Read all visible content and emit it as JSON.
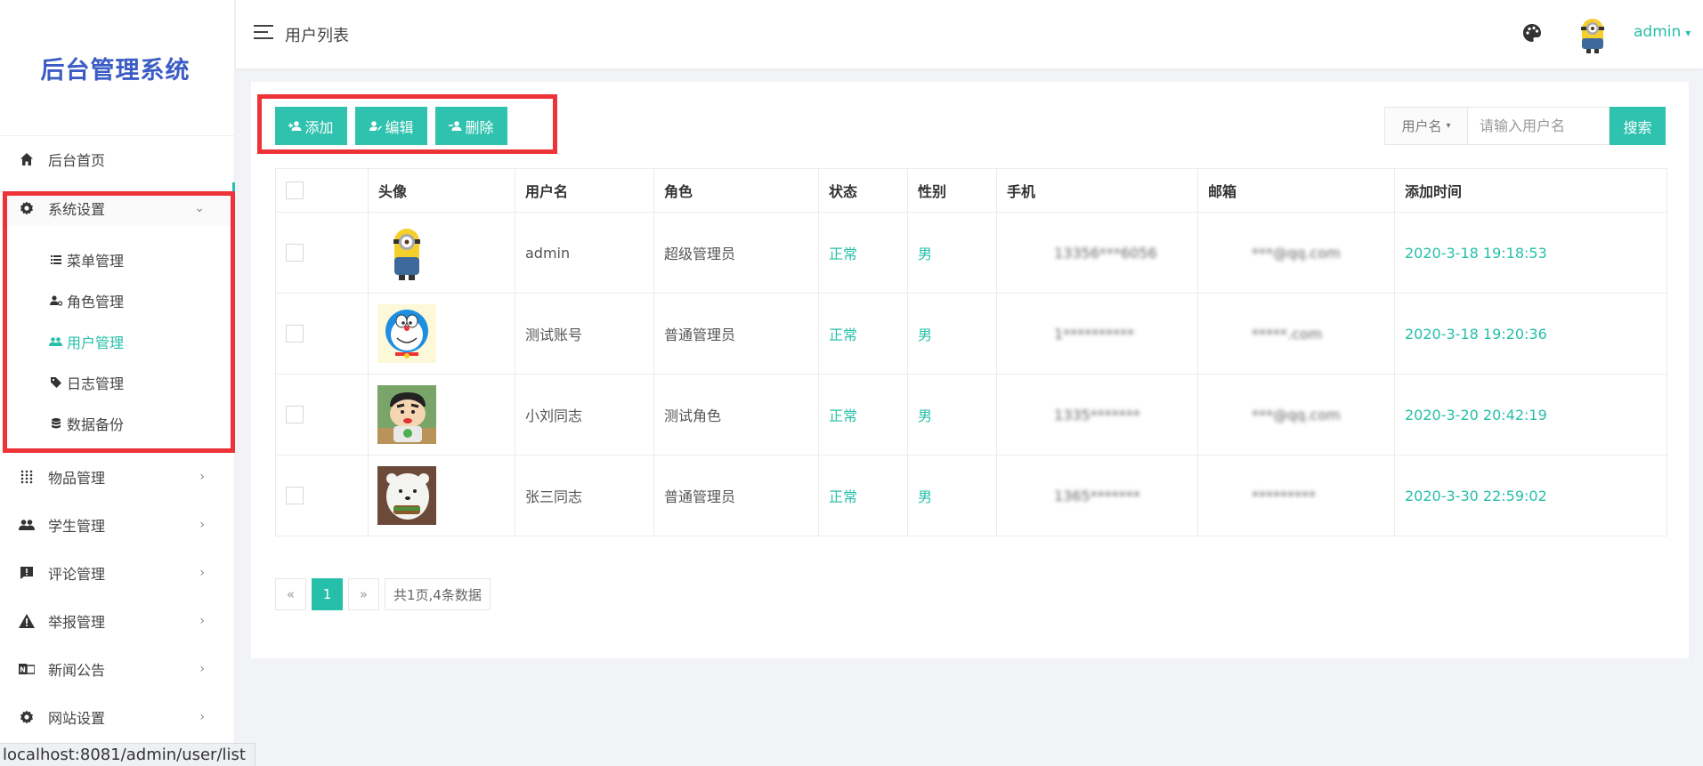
{
  "sidebar": {
    "logo": "后台管理系统",
    "items": [
      {
        "label": "后台首页"
      },
      {
        "label": "系统设置",
        "arrow": "⌄"
      },
      {
        "label": "物品管理",
        "arrow": "›"
      },
      {
        "label": "学生管理",
        "arrow": "›"
      },
      {
        "label": "评论管理",
        "arrow": "›"
      },
      {
        "label": "举报管理",
        "arrow": "›"
      },
      {
        "label": "新闻公告",
        "arrow": "›"
      },
      {
        "label": "网站设置",
        "arrow": "›"
      }
    ],
    "sub_items": [
      {
        "label": "菜单管理"
      },
      {
        "label": "角色管理"
      },
      {
        "label": "用户管理",
        "active": true
      },
      {
        "label": "日志管理"
      },
      {
        "label": "数据备份"
      }
    ]
  },
  "header": {
    "title": "用户列表",
    "user": "admin",
    "caret": "▾"
  },
  "toolbar": {
    "add": "添加",
    "edit": "编辑",
    "delete": "删除",
    "search_field": "用户名",
    "search_caret": "▾",
    "search_placeholder": "请输入用户名",
    "search_button": "搜索"
  },
  "table": {
    "headers": [
      "头像",
      "用户名",
      "角色",
      "状态",
      "性别",
      "手机",
      "邮箱",
      "添加时间"
    ],
    "rows": [
      {
        "avatar": "minion",
        "username": "admin",
        "role": "超级管理员",
        "status": "正常",
        "gender": "男",
        "phone": "13356***6056",
        "email": "***@qq.com",
        "time": "2020-3-18 19:18:53"
      },
      {
        "avatar": "doraemon",
        "username": "测试账号",
        "role": "普通管理员",
        "status": "正常",
        "gender": "男",
        "phone": "1**********",
        "email": "*****.com",
        "time": "2020-3-18 19:20:36"
      },
      {
        "avatar": "crayon-shin",
        "username": "小刘同志",
        "role": "测试角色",
        "status": "正常",
        "gender": "男",
        "phone": "1335*******",
        "email": "***@qq.com",
        "time": "2020-3-20 20:42:19"
      },
      {
        "avatar": "bear",
        "username": "张三同志",
        "role": "普通管理员",
        "status": "正常",
        "gender": "男",
        "phone": "1365*******",
        "email": "*********",
        "time": "2020-3-30 22:59:02"
      }
    ]
  },
  "pagination": {
    "prev": "«",
    "current": "1",
    "next": "»",
    "info": "共1页,4条数据"
  },
  "status_bar": "localhost:8081/admin/user/list",
  "colors": {
    "accent": "#26bfa9",
    "highlight": "#ee3338",
    "logo": "#3b5cc4"
  }
}
